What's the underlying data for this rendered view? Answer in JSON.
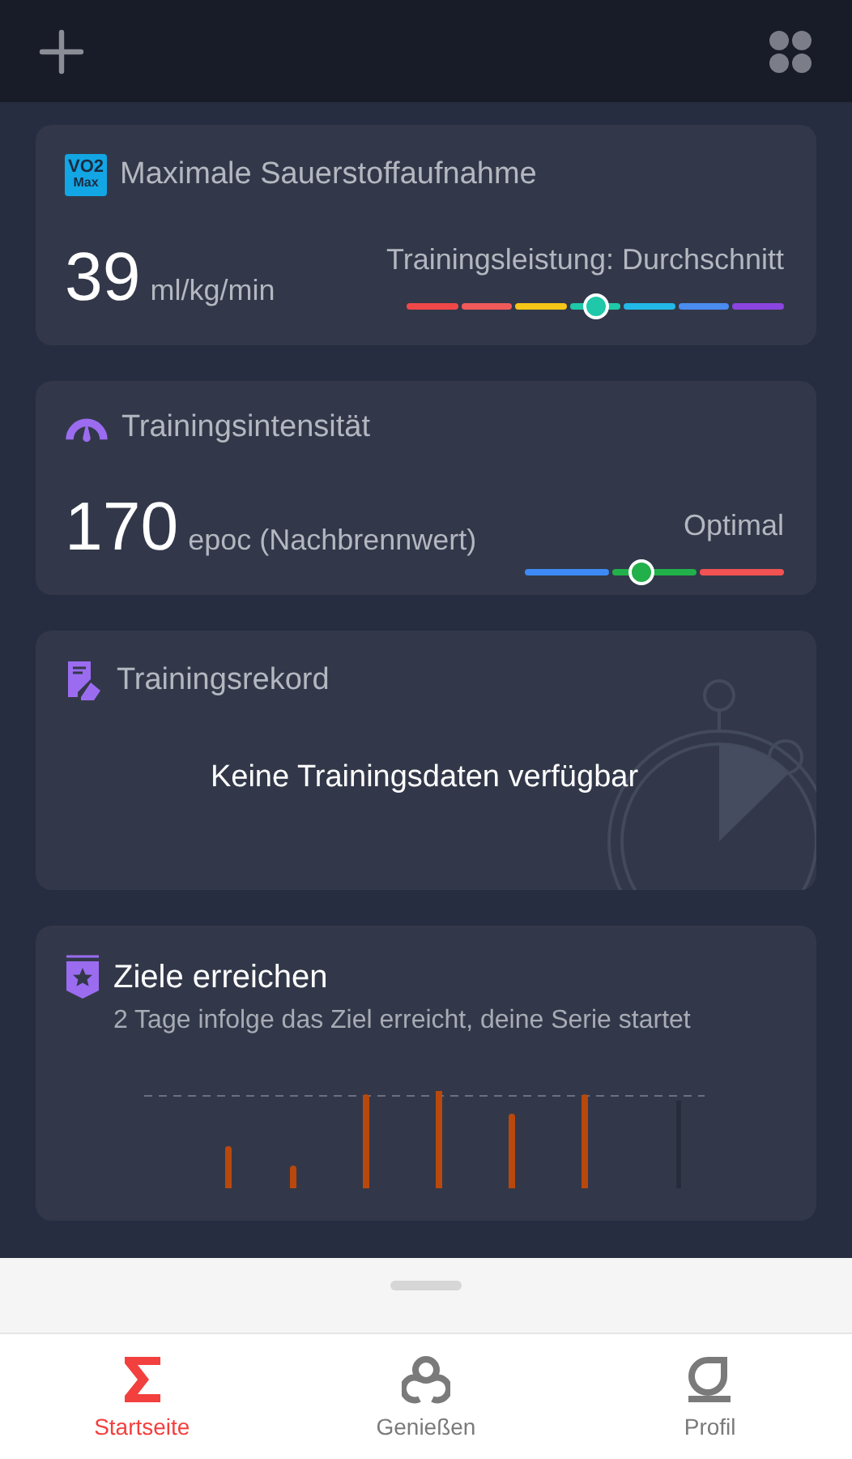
{
  "vo2_card": {
    "badge": [
      "VO2",
      "Max"
    ],
    "title": "Maximale Sauerstoffaufnahme",
    "value": "39",
    "unit": "ml/kg/min",
    "rating": "Trainingsleistung: Durchschnitt",
    "level": 0.5,
    "segments": [
      {
        "color": "#f04848"
      },
      {
        "color": "#f25a5a"
      },
      {
        "color": "#f5c518"
      },
      {
        "color": "#1ec8a8"
      },
      {
        "color": "#22b8e8"
      },
      {
        "color": "#4a8cf0"
      },
      {
        "color": "#8a44e0"
      }
    ]
  },
  "intensity_card": {
    "title": "Trainingsintensität",
    "value": "170",
    "unit": "epoc (Nachbrennwert)",
    "rating": "Optimal",
    "level": 0.45,
    "segments": [
      {
        "color": "#3d8af7"
      },
      {
        "color": "#22b04a"
      },
      {
        "color": "#f25252"
      }
    ]
  },
  "record_card": {
    "title": "Trainingsrekord",
    "message": "Keine Trainingsdaten verfügbar"
  },
  "goals_card": {
    "title": "Ziele erreichen",
    "subtitle": "2 Tage infolge das Ziel erreicht, deine Serie startet"
  },
  "bottom_nav": [
    {
      "label": "Startseite",
      "selected": true
    },
    {
      "label": "Genießen",
      "selected": false
    },
    {
      "label": "Profil",
      "selected": false
    }
  ]
}
